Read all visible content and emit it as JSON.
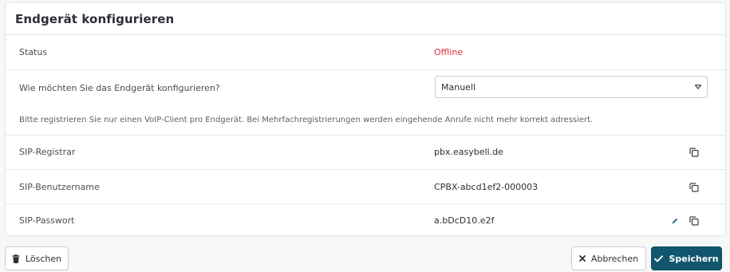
{
  "card": {
    "title": "Endgerät konfigurieren"
  },
  "status": {
    "label": "Status",
    "value": "Offline",
    "value_color": "#d9313b"
  },
  "config": {
    "label": "Wie möchten Sie das Endgerät konfigurieren?",
    "selected": "Manuell",
    "hint": "Bitte registrieren Sie nur einen VoIP-Client pro Endgerät. Bei Mehrfachregistrierungen werden eingehende Anrufe nicht mehr korrekt adressiert."
  },
  "sip": {
    "registrar_label": "SIP-Registrar",
    "registrar_value": "pbx.easybell.de",
    "username_label": "SIP-Benutzername",
    "username_value": "CPBX-abcd1ef2-000003",
    "password_label": "SIP-Passwort",
    "password_value": "a.bDcD10.e2f"
  },
  "actions": {
    "delete_label": "Löschen",
    "cancel_label": "Abbrechen",
    "save_label": "Speichern"
  },
  "colors": {
    "primary": "#12566e",
    "edit_icon": "#1d6e8a"
  },
  "icons": {
    "copy": "copy-icon",
    "edit": "pencil-icon",
    "delete": "trash-icon",
    "cancel": "x-icon",
    "save": "check-icon",
    "select": "caret-down-icon"
  }
}
